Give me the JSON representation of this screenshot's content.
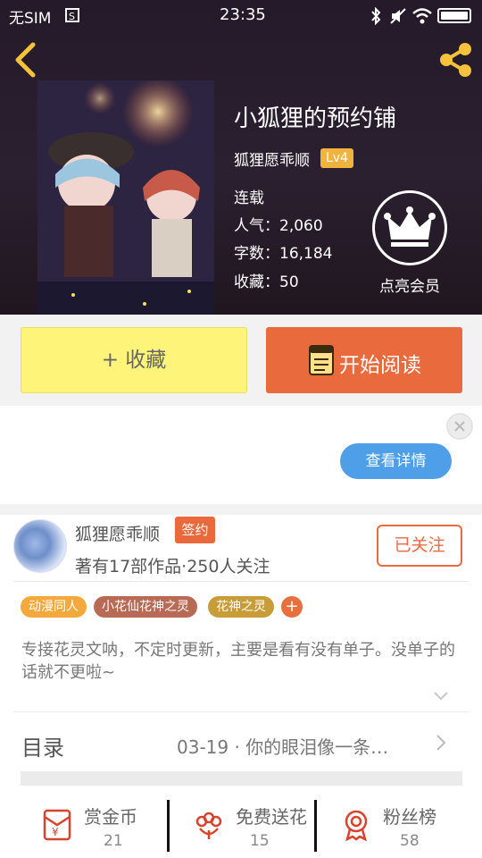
{
  "status_bar": {
    "carrier": "无SIM",
    "time": "23:35",
    "battery_level": 1.0
  },
  "book": {
    "title": "小狐狸的预约铺",
    "author": "狐狸愿乖顺",
    "level": "Lv4",
    "stats": [
      "连载",
      "人气：2,060",
      "字数：16,184",
      "收藏：50"
    ]
  },
  "vip": {
    "label": "点亮会员"
  },
  "actions": {
    "favorite_label": "+ 收藏",
    "read_label": "开始阅读"
  },
  "ad": {
    "detail_label": "查看详情"
  },
  "author_info": {
    "name": "狐狸愿乖顺",
    "signed_badge": "签约",
    "meta": "著有17部作品·250人关注",
    "follow_label": "已关注"
  },
  "tags": [
    "动漫同人",
    "小花仙花神之灵",
    "花神之灵"
  ],
  "tag_add": "+",
  "description": "专接花灵文呐，不定时更新，主要是看有没有单子。没单子的话就不更啦~",
  "toc": {
    "label": "目录",
    "latest": "03-19 · 你的眼泪像一条…"
  },
  "stat_boxes": [
    {
      "label": "赏金币",
      "count": "21",
      "icon": "red-envelope-yen-icon"
    },
    {
      "label": "免费送花",
      "count": "15",
      "icon": "flower-icon"
    },
    {
      "label": "粉丝榜",
      "count": "58",
      "icon": "medal-icon"
    }
  ],
  "colors": {
    "accent_orange": "#e96a3c",
    "favorite_yellow": "#fef47a",
    "detail_blue": "#4f9ee8",
    "level_badge": "#f0b340",
    "icon_red": "#d9432b"
  }
}
